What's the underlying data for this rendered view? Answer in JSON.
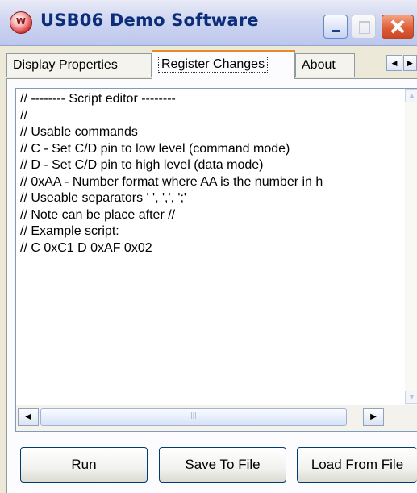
{
  "window": {
    "title": "USB06 Demo Software",
    "icon": "app-logo-icon"
  },
  "title_buttons": {
    "minimize": "minimize-icon",
    "maximize": "maximize-icon",
    "close": "close-icon"
  },
  "tabs": [
    {
      "label": "Display Properties",
      "selected": false
    },
    {
      "label": "Register Changes",
      "selected": true
    },
    {
      "label": "About",
      "selected": false
    }
  ],
  "tab_scroll": {
    "left_glyph": "◀",
    "right_glyph": "▶"
  },
  "editor": {
    "lines": [
      "// -------- Script editor --------",
      "//",
      "// Usable commands",
      "// C - Set C/D pin to low level (command mode)",
      "// D - Set C/D pin to high level (data mode)",
      "// 0xAA - Number format where AA is the number in h",
      "// Useable separators ' ', ',', ';'",
      "// Note can be place after //",
      "// Example script:",
      "// C 0xC1 D 0xAF 0x02"
    ]
  },
  "scroll_glyphs": {
    "up": "▲",
    "down": "▼",
    "left": "◀",
    "right": "▶"
  },
  "buttons": {
    "run": "Run",
    "save": "Save To File",
    "load": "Load From File"
  },
  "colors": {
    "title_text": "#0b2d7a",
    "tab_highlight": "#e68b2c",
    "close_button": "#de5b36"
  }
}
